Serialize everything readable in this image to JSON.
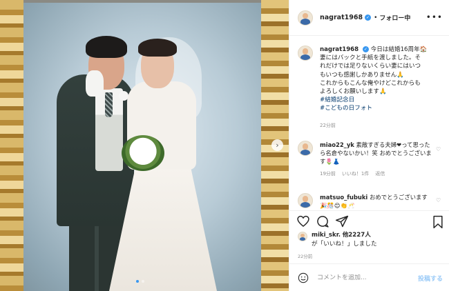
{
  "post": {
    "username": "nagrat1968",
    "follow_separator": "•",
    "follow_label": "フォロー中",
    "more_label": "•••",
    "image_nav_arrow": "›",
    "caption": {
      "username": "nagrat1968",
      "lines": [
        "今日は結婚16周年🏠",
        "妻にはバックと手紙を渡しました。そ",
        "れだけでは足りないくらい妻にはいつ",
        "もいつも感謝しかありません🙏",
        "これからもこんな俺やけどこれからも",
        "よろしくお願いします🙏"
      ],
      "hashtags": [
        "#結婚記念日",
        "#こどもの日フォト"
      ],
      "time": "22分前"
    },
    "comments": [
      {
        "username": "miao22_yk",
        "text": "素敵すぎる夫婦❤って思ったら名倉やないかい！笑 おめでとうございます🌷👗",
        "time": "19分前",
        "likes": "いいね！1件",
        "reply": "返信"
      },
      {
        "username": "matsuo_fubuki",
        "text": "おめでとうございます🎉🎊😊👏🥂",
        "time": "",
        "likes": "",
        "reply": ""
      }
    ],
    "likes": {
      "username": "miki_skr.",
      "suffix": "他2227人",
      "line2": "が「いいね！」しました"
    },
    "post_time": "22分前",
    "comment_input": {
      "placeholder": "コメントを追加...",
      "post_label": "投稿する"
    },
    "icons": {
      "like": "heart-icon",
      "comment": "comment-icon",
      "share": "share-icon",
      "save": "bookmark-icon",
      "emoji": "emoji-icon",
      "verified": "verified-badge-icon"
    },
    "colors": {
      "accent": "#3897f0",
      "link": "#00376b",
      "muted": "#8e8e8e"
    }
  }
}
